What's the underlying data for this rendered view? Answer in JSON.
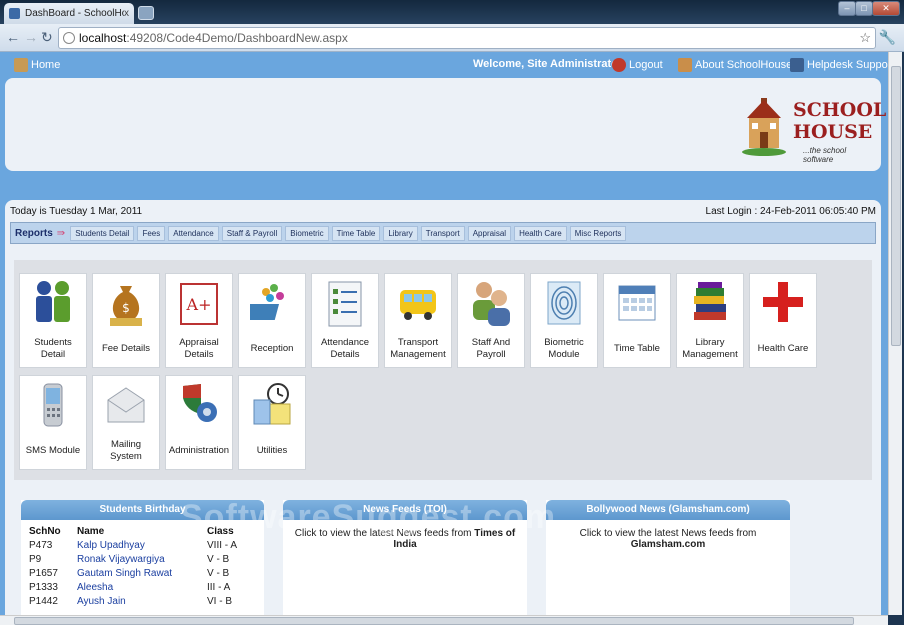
{
  "browser": {
    "tab_title": "DashBoard - SchoolHouse",
    "tab_close": "x",
    "url_host": "localhost",
    "url_rest": ":49208/Code4Demo/DashboardNew.aspx"
  },
  "topnav": {
    "home": "Home",
    "welcome": "Welcome, Site Administrator",
    "logout": "Logout",
    "about": "About SchoolHouse",
    "helpdesk": "Helpdesk Support"
  },
  "logo": {
    "line1": "SCHOOL",
    "line2": "HOUSE",
    "tagline": "...the school software"
  },
  "status": {
    "today": "Today is Tuesday 1 Mar, 2011",
    "last_login": "Last Login : 24-Feb-2011 06:05:40 PM"
  },
  "reports": {
    "label": "Reports",
    "arrow": "⇛",
    "items": [
      "Students Detail",
      "Fees",
      "Attendance",
      "Staff & Payroll",
      "Biometric",
      "Time Table",
      "Library",
      "Transport",
      "Appraisal",
      "Health Care",
      "Misc Reports"
    ]
  },
  "modules": [
    {
      "label": "Students Detail",
      "icon": "students-icon"
    },
    {
      "label": "Fee Details",
      "icon": "money-bag-icon"
    },
    {
      "label": "Appraisal Details",
      "icon": "grade-icon"
    },
    {
      "label": "Reception",
      "icon": "reception-icon"
    },
    {
      "label": "Attendance Details",
      "icon": "checklist-icon"
    },
    {
      "label": "Transport Management",
      "icon": "bus-icon"
    },
    {
      "label": "Staff And Payroll",
      "icon": "staff-icon"
    },
    {
      "label": "Biometric Module",
      "icon": "fingerprint-icon"
    },
    {
      "label": "Time Table",
      "icon": "calendar-icon"
    },
    {
      "label": "Library Management",
      "icon": "books-icon"
    },
    {
      "label": "Health Care",
      "icon": "red-cross-icon"
    },
    {
      "label": "SMS Module",
      "icon": "phone-icon"
    },
    {
      "label": "Mailing System",
      "icon": "envelope-icon"
    },
    {
      "label": "Administration",
      "icon": "shield-icon"
    },
    {
      "label": "Utilities",
      "icon": "utilities-icon"
    }
  ],
  "birthdays": {
    "title": "Students Birthday",
    "headers": [
      "SchNo",
      "Name",
      "Class"
    ],
    "rows": [
      [
        "P473",
        "Kalp Upadhyay",
        "VIII - A"
      ],
      [
        "P9",
        "Ronak Vijaywargiya",
        "V - B"
      ],
      [
        "P1657",
        "Gautam Singh Rawat",
        "V - B"
      ],
      [
        "P1333",
        "Aleesha",
        "III - A"
      ],
      [
        "P1442",
        "Ayush Jain",
        "VI - B"
      ]
    ]
  },
  "news": {
    "title": "News Feeds (TOI)",
    "text": "Click to view the latest News feeds from ",
    "source": "Times of India"
  },
  "bollywood": {
    "title": "Bollywood News (Glamsham.com)",
    "text": "Click to view the latest News feeds from ",
    "source": "Glamsham.com"
  },
  "watermark": "SoftwareSuggest.com",
  "colors": {
    "accent": "#6aa6de",
    "brand": "#9b1f1f",
    "link": "#1b3fa0"
  }
}
